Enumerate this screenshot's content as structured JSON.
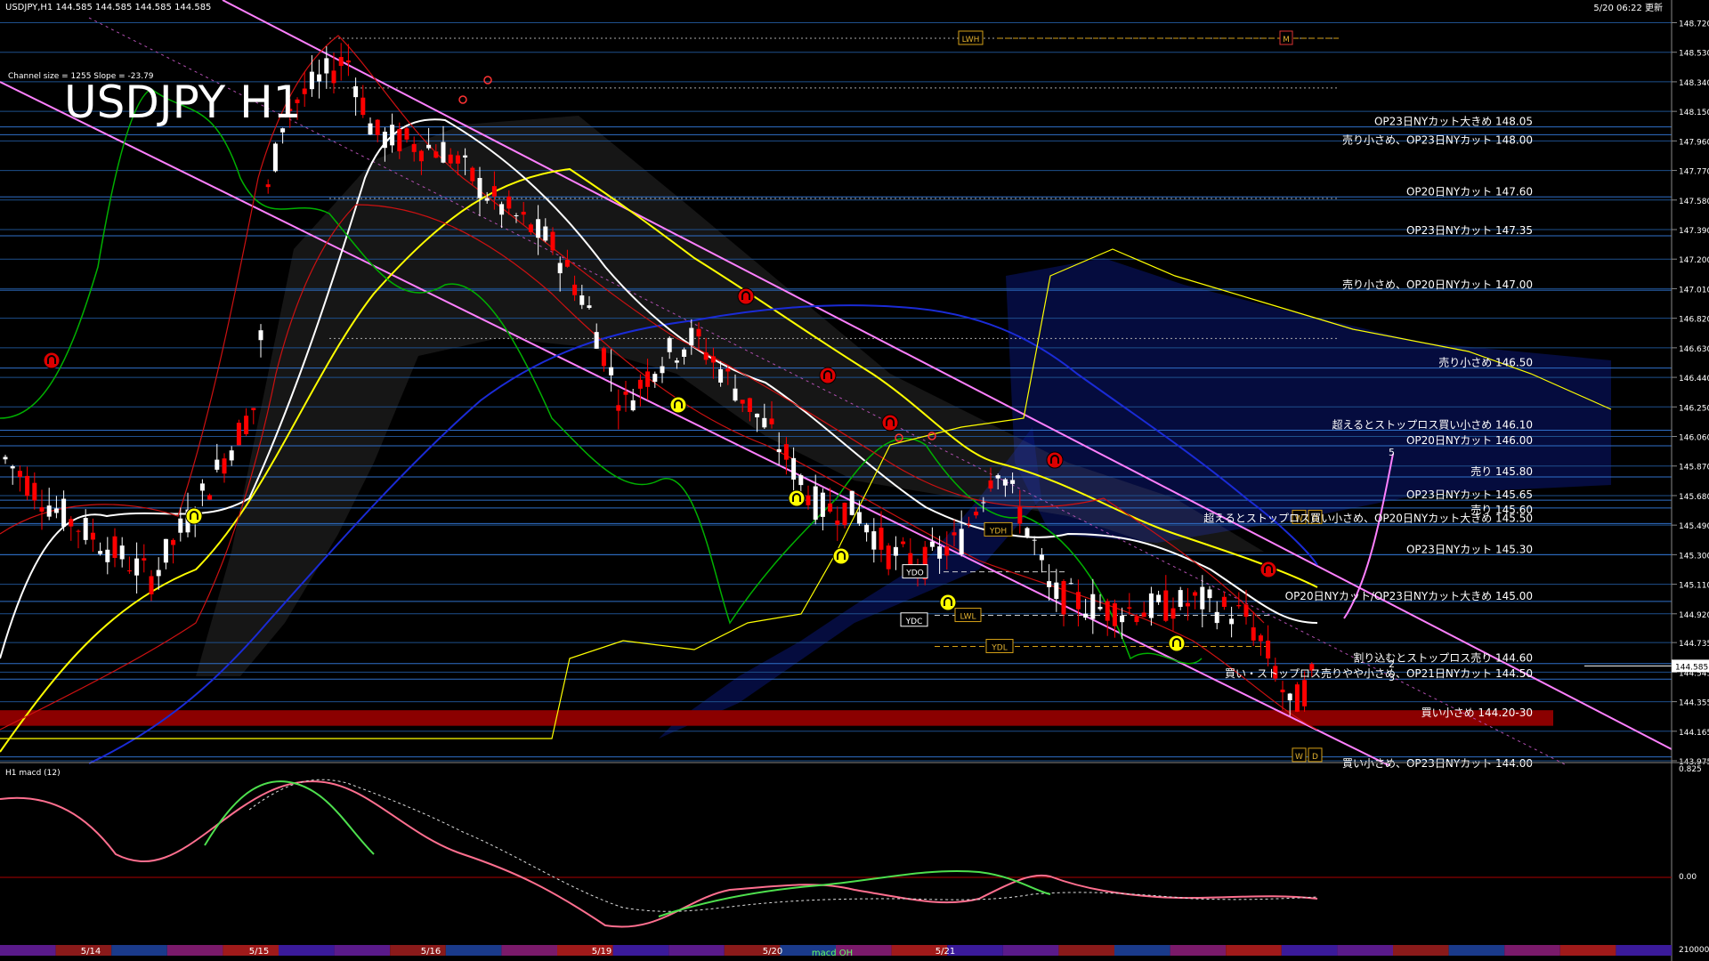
{
  "header": {
    "symbol_info": "USDJPY,H1  144.585 144.585 144.585 144.585",
    "timestamp": "5/20 06:22 更新"
  },
  "chart_title": "USDJPY H1",
  "channel_info": "Channel size = 1255 Slope = -23.79",
  "chart_data": {
    "type": "candlestick",
    "symbol": "USDJPY",
    "timeframe": "H1",
    "price_axis": {
      "ylim": [
        143.975,
        148.74
      ],
      "ticks": [
        148.72,
        148.53,
        148.34,
        148.15,
        147.96,
        147.77,
        147.58,
        147.39,
        147.2,
        147.01,
        146.82,
        146.63,
        146.44,
        146.25,
        146.06,
        145.87,
        145.68,
        145.49,
        145.3,
        145.11,
        144.92,
        144.735,
        144.545,
        144.355,
        144.165,
        143.975
      ],
      "current_price": 144.585
    },
    "date_labels": [
      "5/14",
      "5/15",
      "5/16",
      "5/19",
      "5/20",
      "5/21"
    ],
    "level_labels": [
      {
        "label": "OP23日NYカット大きめ 148.05",
        "price": 148.05
      },
      {
        "label": "売り小さめ、OP23日NYカット 148.00",
        "price": 148.0
      },
      {
        "label": "OP20日NYカット 147.60",
        "price": 147.6
      },
      {
        "label": "OP23日NYカット 147.35",
        "price": 147.35
      },
      {
        "label": "売り小さめ、OP20日NYカット 147.00",
        "price": 147.0
      },
      {
        "label": "売り小さめ 146.50",
        "price": 146.5
      },
      {
        "label": "超えるとストップロス買い小さめ 146.10",
        "price": 146.1
      },
      {
        "label": "OP20日NYカット 146.00",
        "price": 146.0
      },
      {
        "label": "売り 145.80",
        "price": 145.8
      },
      {
        "label": "OP23日NYカット 145.65",
        "price": 145.65
      },
      {
        "label": "売り 145.60",
        "price": 145.6
      },
      {
        "label": "超えるとストップロス買い小さめ、OP20日NYカット大きめ 145.50",
        "price": 145.5
      },
      {
        "label": "OP23日NYカット 145.30",
        "price": 145.3
      },
      {
        "label": "OP20日NYカット/OP23日NYカット大きめ 145.00",
        "price": 145.0
      },
      {
        "label": "割り込むとストップロス売り 144.60",
        "price": 144.6
      },
      {
        "label": "買い・ストップロス売りやや小さめ、OP21日NYカット 144.50",
        "price": 144.5
      },
      {
        "label": "買い小さめ 144.20-30",
        "price": 144.25
      },
      {
        "label": "買い小さめ、OP23日NYカット 144.00",
        "price": 144.0
      }
    ],
    "level_box_labels": [
      {
        "label": "LWH",
        "price": 148.62
      },
      {
        "label": "YDH",
        "price": 145.46
      },
      {
        "label": "YDO",
        "price": 145.19
      },
      {
        "label": "YDC",
        "price": 144.88
      },
      {
        "label": "LWL",
        "price": 144.91
      },
      {
        "label": "YDL",
        "price": 144.71
      },
      {
        "label": "W",
        "price": 145.54
      },
      {
        "label": "D",
        "price": 145.54
      },
      {
        "label": "W",
        "price": 144.01
      },
      {
        "label": "D",
        "price": 144.01
      },
      {
        "label": "M",
        "price": 148.62
      }
    ],
    "wave_labels": [
      "5",
      "2",
      "3"
    ],
    "macd": {
      "title": "H1  macd (12)",
      "ticks": [
        0.825,
        0.0,
        210000
      ],
      "zero_label": "0.00"
    },
    "bottom_label": "macd OH"
  },
  "colors": {
    "background": "#000000",
    "grid": "#1e4f8c",
    "bull_candle": "#ffffff",
    "bear_candle": "#ff0000",
    "ma_white": "#ffffff",
    "ma_yellow": "#ffff00",
    "ma_blue": "#1020d0",
    "channel": "#ff80ff",
    "support_band": "#8b0000",
    "cloud_blue": "#1030ff",
    "green": "#00b000",
    "box_orange": "#d4a017"
  }
}
